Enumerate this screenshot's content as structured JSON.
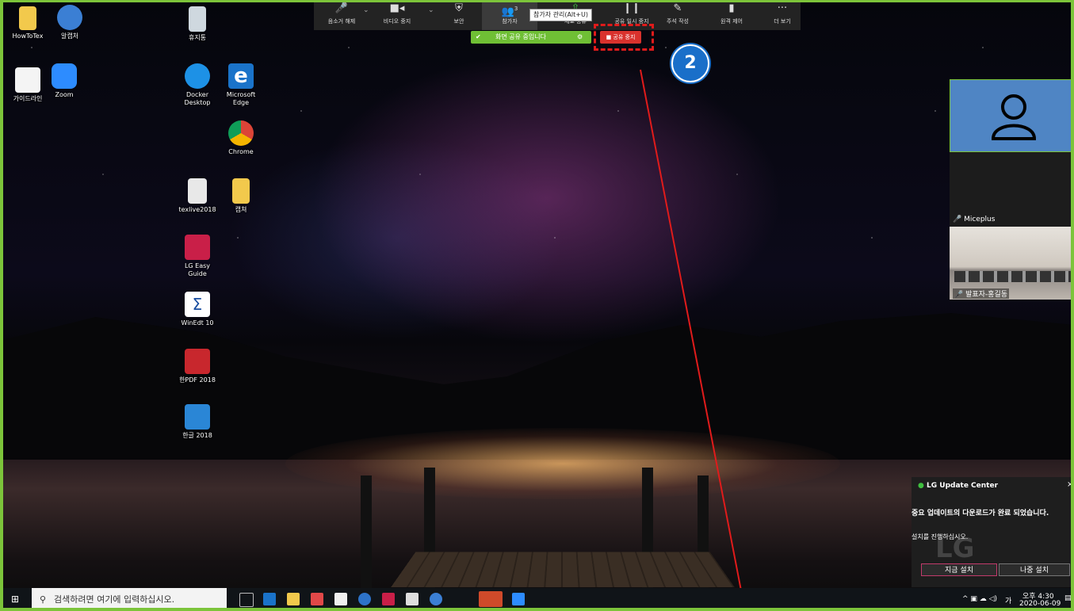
{
  "desktop": {
    "icons": [
      {
        "label": "HowToTex",
        "icon": "folder-icon"
      },
      {
        "label": "알캡처",
        "icon": "alcapture-icon"
      },
      {
        "label": "휴지통",
        "icon": "recycle-bin-icon"
      },
      {
        "label": "가이드라인",
        "icon": "document-icon"
      },
      {
        "label": "Zoom",
        "icon": "zoom-icon"
      },
      {
        "label": "Docker\nDesktop",
        "icon": "docker-icon"
      },
      {
        "label": "Microsoft\nEdge",
        "icon": "edge-icon"
      },
      {
        "label": "Chrome",
        "icon": "chrome-icon"
      },
      {
        "label": "texlive2018",
        "icon": "file-icon"
      },
      {
        "label": "캡쳐",
        "icon": "folder-icon"
      },
      {
        "label": "LG Easy\nGuide",
        "icon": "lg-guide-icon"
      },
      {
        "label": "WinEdt 10",
        "icon": "winedt-icon"
      },
      {
        "label": "한PDF 2018",
        "icon": "hanpdf-icon"
      },
      {
        "label": "한글 2018",
        "icon": "hangul-icon"
      }
    ]
  },
  "zoom_toolbar": {
    "buttons": [
      {
        "label": "음소거 해제",
        "icon": "mic-muted-icon",
        "glyph": "🎤"
      },
      {
        "label": "비디오 중지",
        "icon": "video-icon",
        "glyph": "■◂"
      },
      {
        "label": "보안",
        "icon": "shield-icon",
        "glyph": "⛨"
      },
      {
        "label": "참가자",
        "icon": "participants-icon",
        "glyph": "👥",
        "count": "3"
      },
      {
        "label": "새로 공유",
        "icon": "new-share-icon",
        "glyph": "⇧"
      },
      {
        "label": "공유 일시 중지",
        "icon": "pause-icon",
        "glyph": "❙❙"
      },
      {
        "label": "주석 작성",
        "icon": "pencil-icon",
        "glyph": "✎"
      },
      {
        "label": "원격 제어",
        "icon": "mouse-icon",
        "glyph": "▮"
      },
      {
        "label": "더 보기",
        "icon": "more-icon",
        "glyph": "···"
      }
    ],
    "tooltip": "참가자 관리(Alt+U)",
    "share_status": "화면 공유 중입니다",
    "stop_share": "■ 공유 중지"
  },
  "annotation": {
    "marker_number": "2",
    "highlight_color": "#e01b1b",
    "marker_color": "#1a6fc9"
  },
  "video_panel": {
    "participants": [
      {
        "name": "Miceplus"
      },
      {
        "name": "발표자-홍길동"
      }
    ]
  },
  "notification": {
    "app": "LG Update Center",
    "title": "중요 업데이트의 다운로드가 완료 되었습니다.",
    "message": "설치를 진행하십시오.",
    "install_now": "지금 설치",
    "install_later": "나중 설치",
    "close": "×",
    "background_logo": "LG"
  },
  "taskbar": {
    "search_placeholder": "검색하려면 여기에 입력하십시오.",
    "ime": "가",
    "time": "오후 4:30",
    "date": "2020-06-09"
  },
  "colors": {
    "share_green": "#7cc43a",
    "stop_red": "#d9322d",
    "toolbar_bg": "#232323"
  }
}
